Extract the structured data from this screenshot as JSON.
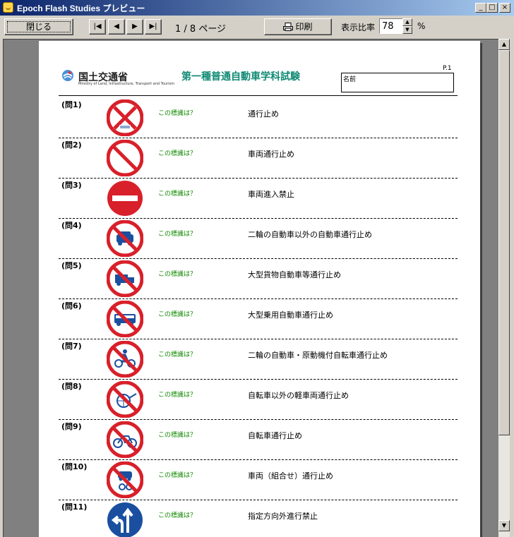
{
  "window": {
    "title": "Epoch Flash Studies  プレビュー",
    "controls": [
      "_",
      "□",
      "×"
    ]
  },
  "toolbar": {
    "close_label": "閉じる",
    "nav": [
      "|◀",
      "◀",
      "▶",
      "▶|"
    ],
    "page_indicator": "1 / 8 ページ",
    "print_label": "印刷",
    "zoom_label": "表示比率",
    "zoom_value": "78",
    "zoom_unit": "%"
  },
  "document": {
    "ministry_name": "国土交通省",
    "ministry_subtitle": "Ministry of Land, Infrastructure, Transport and Tourism",
    "title": "第一種普通自動車学科試験",
    "page_label": "P.1",
    "name_label": "名前",
    "questions": [
      {
        "number": "(問1)",
        "prompt": "この標識は？",
        "answer": "通行止め",
        "sign": "no-passage-sign"
      },
      {
        "number": "(問2)",
        "prompt": "この標識は？",
        "answer": "車両通行止め",
        "sign": "no-vehicles-sign"
      },
      {
        "number": "(問3)",
        "prompt": "この標識は？",
        "answer": "車両進入禁止",
        "sign": "no-entry-sign"
      },
      {
        "number": "(問4)",
        "prompt": "この標識は？",
        "answer": "二輪の自動車以外の自動車通行止め",
        "sign": "no-cars-sign"
      },
      {
        "number": "(問5)",
        "prompt": "この標識は？",
        "answer": "大型貨物自動車等通行止め",
        "sign": "no-trucks-sign"
      },
      {
        "number": "(問6)",
        "prompt": "この標識は？",
        "answer": "大型乗用自動車通行止め",
        "sign": "no-buses-sign"
      },
      {
        "number": "(問7)",
        "prompt": "この標識は？",
        "answer": "二輪の自動車・原動機付自転車通行止め",
        "sign": "no-motorcycles-sign"
      },
      {
        "number": "(問8)",
        "prompt": "この標識は？",
        "answer": "自転車以外の軽車両通行止め",
        "sign": "no-light-vehicles-sign"
      },
      {
        "number": "(問9)",
        "prompt": "この標識は？",
        "answer": "自転車通行止め",
        "sign": "no-bicycles-sign"
      },
      {
        "number": "(問10)",
        "prompt": "この標識は？",
        "answer": "車両（組合せ）通行止め",
        "sign": "no-combination-sign"
      },
      {
        "number": "(問11)",
        "prompt": "この標識は？",
        "answer": "指定方向外進行禁止",
        "sign": "designated-direction-sign"
      }
    ]
  },
  "colors": {
    "title_green": "#118a74",
    "prompt_green": "#118a00",
    "sign_red": "#d8202a",
    "sign_blue": "#1a4fa0",
    "titlebar_dark": "#0a246a"
  }
}
